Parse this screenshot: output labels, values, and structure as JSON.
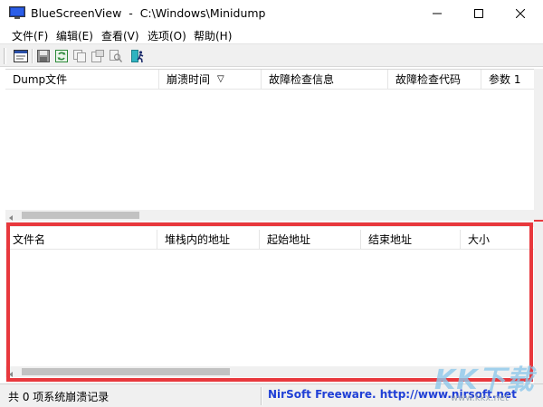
{
  "window": {
    "title": "BlueScreenView  -  C:\\Windows\\Minidump"
  },
  "menu": [
    {
      "label": "文件(F)"
    },
    {
      "label": "编辑(E)"
    },
    {
      "label": "查看(V)"
    },
    {
      "label": "选项(O)"
    },
    {
      "label": "帮助(H)"
    }
  ],
  "toolbar": {
    "icons": [
      "properties-icon",
      "save-icon",
      "refresh-icon",
      "copy-icon",
      "html-report-icon",
      "find-icon",
      "exit-icon"
    ]
  },
  "upper_list": {
    "columns": [
      "Dump文件",
      "崩溃时间",
      "故障检查信息",
      "故障检查代码",
      "参数 1"
    ],
    "sort_indicator": "▽",
    "rows": []
  },
  "lower_list": {
    "columns": [
      "文件名",
      "堆栈内的地址",
      "起始地址",
      "结束地址",
      "大小"
    ],
    "rows": []
  },
  "status": {
    "count_text": "共 0 项系统崩溃记录",
    "link_text": "NirSoft Freeware.  http://www.nirsoft.net"
  },
  "colors": {
    "highlight": "#e8383d",
    "link": "#1f3fd6"
  },
  "watermark": {
    "letters": "KK下载",
    "url": "www.kkx.net"
  }
}
